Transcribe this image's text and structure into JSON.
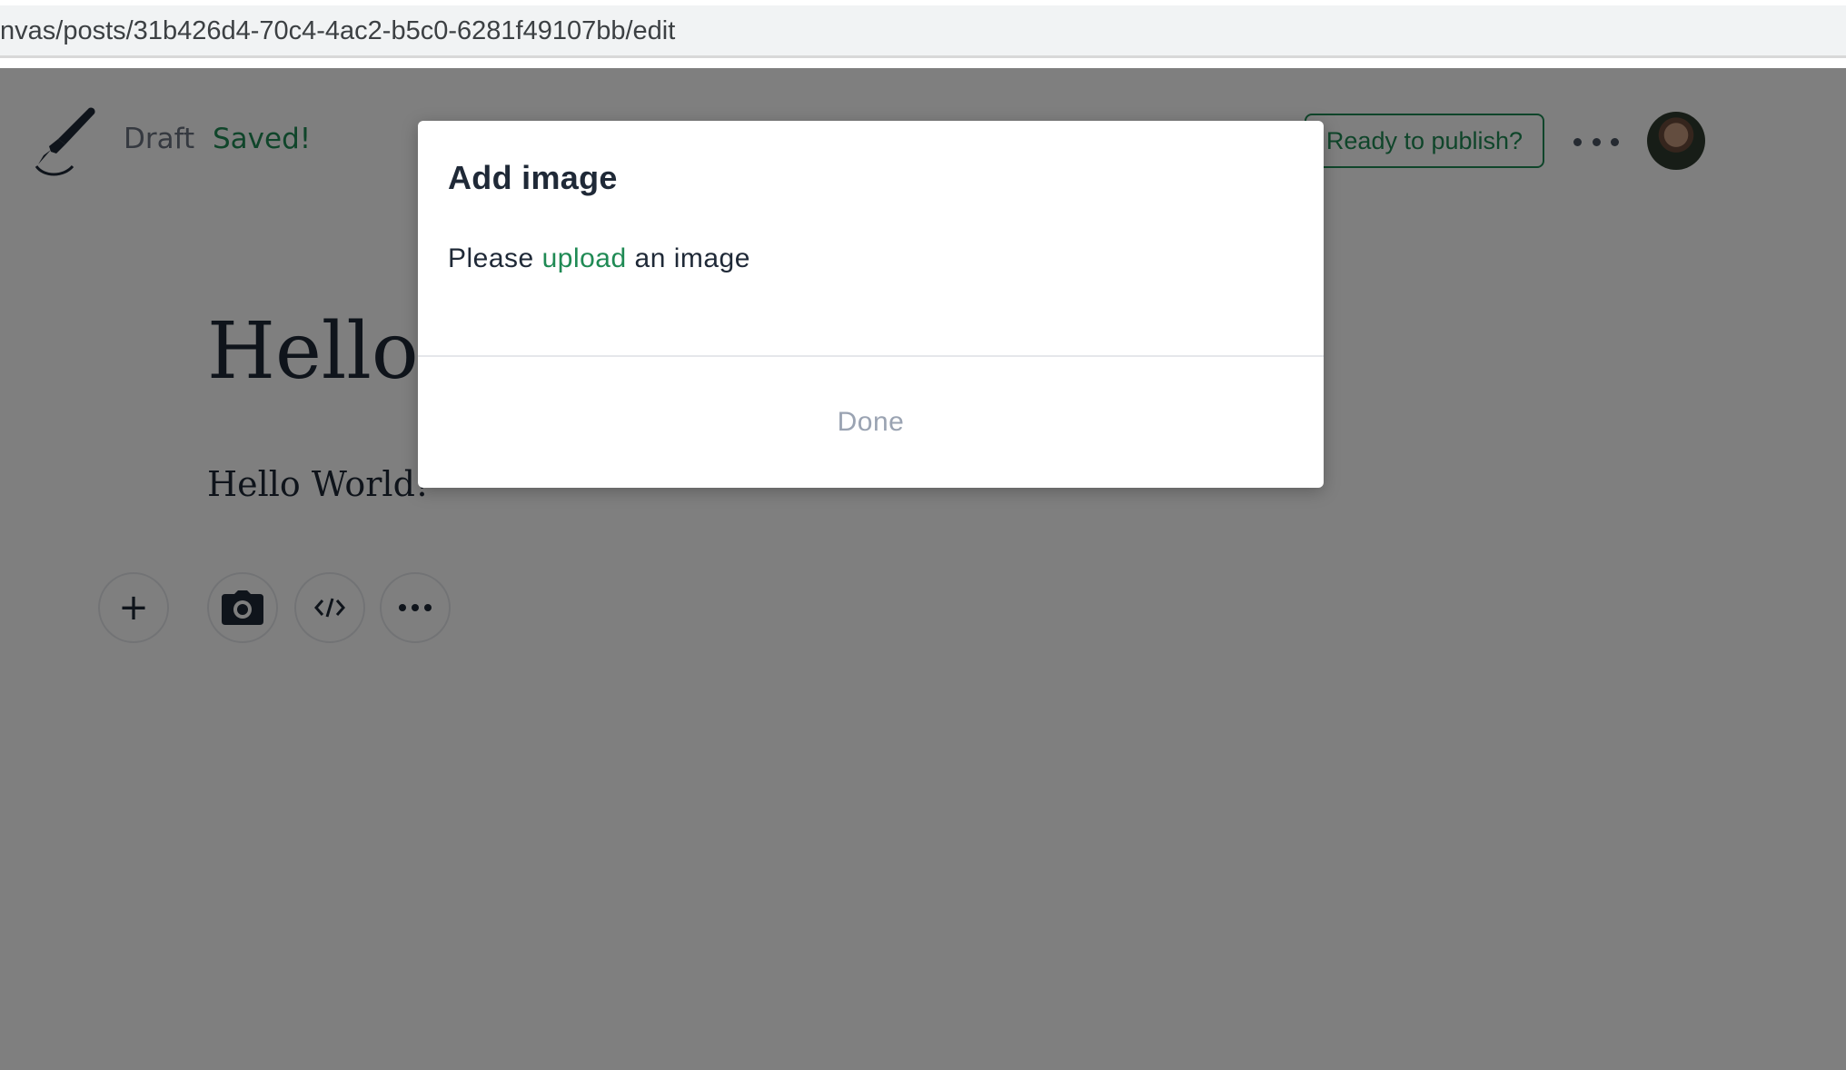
{
  "browser": {
    "url": "nvas/posts/31b426d4-70c4-4ac2-b5c0-6281f49107bb/edit"
  },
  "header": {
    "draft_label": "Draft",
    "saved_label": "Saved!",
    "publish_label": "Ready to publish?",
    "more_icon": "more-dots-icon",
    "avatar_icon": "user-avatar"
  },
  "post": {
    "title": "Hello",
    "body": "Hello World!"
  },
  "toolbar": {
    "add_icon": "plus-icon",
    "add_glyph": "+",
    "image_icon": "camera-icon",
    "embed_icon": "code-icon",
    "more_icon": "more-dots-icon"
  },
  "modal": {
    "title": "Add image",
    "text_before": "Please ",
    "link_text": "upload",
    "text_after": " an image",
    "done_label": "Done"
  },
  "colors": {
    "accent": "#1f8a54",
    "muted": "#6b7280",
    "overlay": "rgba(0,0,0,0.5)",
    "done": "#9aa3b2"
  }
}
